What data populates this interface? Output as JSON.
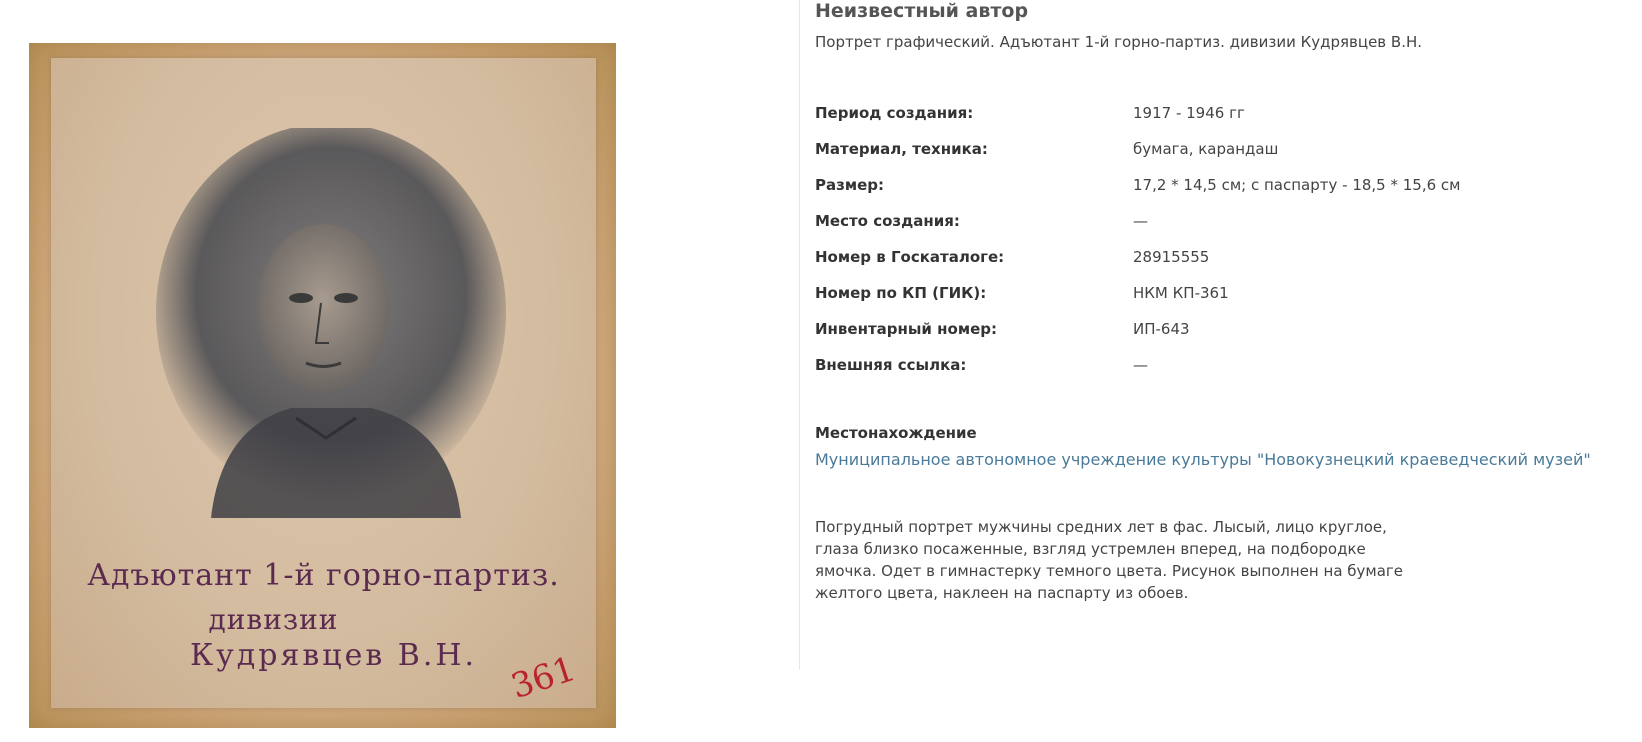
{
  "artwork": {
    "inscription": {
      "line1": "Адъютант 1-й горно-партиз.",
      "line2": "дивизии",
      "line3": "Кудрявцев В.Н."
    },
    "inventory_mark": "361"
  },
  "record": {
    "author": "Неизвестный автор",
    "title": "Портрет графический. Адъютант 1-й горно-партиз. дивизии Кудрявцев В.Н.",
    "properties": [
      {
        "label": "Период создания:",
        "value": "1917 - 1946 гг"
      },
      {
        "label": "Материал, техника:",
        "value": "бумага, карандаш"
      },
      {
        "label": "Размер:",
        "value": "17,2 * 14,5 см; с паспарту - 18,5 * 15,6 см"
      },
      {
        "label": "Место создания:",
        "value": "—"
      },
      {
        "label": "Номер в Госкаталоге:",
        "value": "28915555"
      },
      {
        "label": "Номер по КП (ГИК):",
        "value": "НКМ КП-361"
      },
      {
        "label": "Инвентарный номер:",
        "value": "ИП-643"
      },
      {
        "label": "Внешняя ссылка:",
        "value": "—"
      }
    ],
    "location_title": "Местонахождение",
    "location_link": "Муниципальное автономное учреждение культуры \"Новокузнецкий краеведческий музей\"",
    "description": "Погрудный портрет мужчины средних лет в фас. Лысый, лицо круглое, глаза близко посаженные, взгляд устремлен вперед, на подбородке ямочка. Одет в гимнастерку темного цвета. Рисунок выполнен на бумаге желтого цвета, наклеен на паспарту из обоев."
  },
  "colors": {
    "link": "#4a7a99",
    "ink": "#5b2a4f",
    "inventory_red": "#b8232e"
  }
}
